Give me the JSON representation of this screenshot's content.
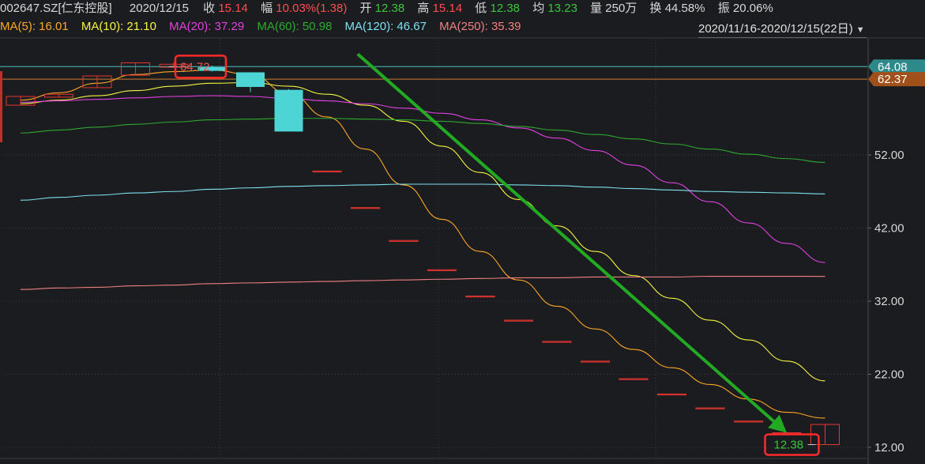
{
  "header": {
    "code": "002647.SZ[仁东控股]",
    "date": "2020/12/15",
    "close_label": "收",
    "close": "15.14",
    "amp_label": "幅",
    "amp": "10.03%(1.38)",
    "open_label": "开",
    "open": "12.38",
    "high_label": "高",
    "high": "15.14",
    "low_label": "低",
    "low": "12.38",
    "avg_label": "均",
    "avg": "13.23",
    "vol_label": "量",
    "vol": "250万",
    "turnover_label": "换",
    "turnover": "44.58%",
    "swing_label": "振",
    "swing": "20.06%"
  },
  "ma": {
    "ma5": "MA(5): 16.01",
    "ma10": "MA(10): 21.10",
    "ma20": "MA(20): 37.29",
    "ma60": "MA(60): 50.98",
    "ma120": "MA(120): 46.67",
    "ma250": "MA(250): 35.39"
  },
  "range": {
    "label": "2020/11/16-2020/12/15(22日)",
    "dropdown_icon": "chevron-down-icon"
  },
  "colors": {
    "up": "#e8352f",
    "down": "#4dd4d4",
    "ma5": "#ffa726",
    "ma10": "#f5f542",
    "ma20": "#e040e0",
    "ma60": "#2eaa2e",
    "ma120": "#7fe0f0",
    "ma250": "#f08080",
    "arrow": "#22aa22"
  },
  "chart_data": {
    "type": "candlestick",
    "ylim": [
      10,
      68
    ],
    "y_ticks": [
      "52.00",
      "42.00",
      "32.00",
      "22.00",
      "12.00"
    ],
    "y_tick_values": [
      52,
      42,
      32,
      22,
      12
    ],
    "price_markers": [
      {
        "label": "64.08",
        "value": 64.08
      },
      {
        "label": "62.37",
        "value": 62.37
      }
    ],
    "annotations": {
      "high": "64.72",
      "high_value": 64.72,
      "low": "12.38",
      "low_value": 12.38
    },
    "candles": [
      {
        "o": 58.8,
        "c": 60.0,
        "h": 60.0,
        "l": 58.8
      },
      {
        "o": 59.9,
        "c": 60.3,
        "h": 60.3,
        "l": 59.9
      },
      {
        "o": 61.2,
        "c": 62.8,
        "h": 62.8,
        "l": 61.2
      },
      {
        "o": 62.9,
        "c": 64.6,
        "h": 64.6,
        "l": 62.9
      },
      {
        "o": 64.0,
        "c": 64.4,
        "h": 64.72,
        "l": 64.0
      },
      {
        "o": 64.0,
        "c": 63.5,
        "h": 64.2,
        "l": 63.4
      },
      {
        "o": 63.3,
        "c": 61.3,
        "h": 63.3,
        "l": 60.6
      },
      {
        "o": 60.9,
        "c": 55.2,
        "h": 61.0,
        "l": 55.2
      },
      {
        "o": 49.8,
        "c": 49.8,
        "h": 49.8,
        "l": 49.8
      },
      {
        "o": 44.8,
        "c": 44.8,
        "h": 44.8,
        "l": 44.8
      },
      {
        "o": 40.3,
        "c": 40.3,
        "h": 40.3,
        "l": 40.3
      },
      {
        "o": 36.3,
        "c": 36.3,
        "h": 36.3,
        "l": 36.3
      },
      {
        "o": 32.7,
        "c": 32.7,
        "h": 32.7,
        "l": 32.7
      },
      {
        "o": 29.4,
        "c": 29.4,
        "h": 29.4,
        "l": 29.4
      },
      {
        "o": 26.5,
        "c": 26.5,
        "h": 26.5,
        "l": 26.5
      },
      {
        "o": 23.8,
        "c": 23.8,
        "h": 23.8,
        "l": 23.8
      },
      {
        "o": 21.4,
        "c": 21.4,
        "h": 21.4,
        "l": 21.4
      },
      {
        "o": 19.3,
        "c": 19.3,
        "h": 19.3,
        "l": 19.3
      },
      {
        "o": 17.4,
        "c": 17.4,
        "h": 17.4,
        "l": 17.4
      },
      {
        "o": 15.6,
        "c": 15.6,
        "h": 15.6,
        "l": 15.6
      },
      {
        "o": 14.0,
        "c": 14.0,
        "h": 14.0,
        "l": 14.0
      },
      {
        "o": 12.38,
        "c": 15.14,
        "h": 15.14,
        "l": 12.38
      }
    ],
    "ma_lines": [
      {
        "name": "MA(5)",
        "key": "ma5",
        "values": [
          59.5,
          60.5,
          61.8,
          63.0,
          63.4,
          63.6,
          63.0,
          60.4,
          57.2,
          52.8,
          47.9,
          43.2,
          38.8,
          34.9,
          31.3,
          28.2,
          25.4,
          22.9,
          20.6,
          18.6,
          16.8,
          16.01
        ]
      },
      {
        "name": "MA(10)",
        "key": "ma10",
        "values": [
          59.0,
          59.5,
          60.1,
          60.8,
          61.4,
          61.8,
          61.9,
          61.4,
          60.3,
          58.8,
          56.6,
          53.2,
          49.6,
          45.9,
          42.3,
          38.8,
          35.5,
          32.4,
          29.4,
          26.7,
          23.8,
          21.1
        ]
      },
      {
        "name": "MA(20)",
        "key": "ma20",
        "values": [
          59.2,
          59.4,
          59.6,
          59.8,
          60.0,
          60.1,
          60.0,
          59.7,
          59.4,
          59.0,
          58.4,
          57.7,
          56.8,
          55.7,
          54.3,
          52.6,
          50.6,
          48.2,
          45.6,
          42.7,
          39.9,
          37.29
        ]
      },
      {
        "name": "MA(60)",
        "key": "ma60",
        "values": [
          55.0,
          55.4,
          55.8,
          56.2,
          56.5,
          56.8,
          56.9,
          57.0,
          57.0,
          56.9,
          56.8,
          56.6,
          56.3,
          55.9,
          55.4,
          54.8,
          54.2,
          53.5,
          52.8,
          52.1,
          51.5,
          50.98
        ]
      },
      {
        "name": "MA(120)",
        "key": "ma120",
        "values": [
          45.8,
          46.2,
          46.5,
          46.8,
          47.0,
          47.3,
          47.5,
          47.7,
          47.8,
          47.9,
          48.0,
          48.0,
          48.0,
          47.9,
          47.8,
          47.6,
          47.4,
          47.2,
          47.0,
          46.9,
          46.8,
          46.67
        ]
      },
      {
        "name": "MA(250)",
        "key": "ma250",
        "values": [
          33.6,
          33.8,
          33.9,
          34.1,
          34.2,
          34.4,
          34.5,
          34.6,
          34.7,
          34.8,
          34.9,
          35.0,
          35.1,
          35.2,
          35.2,
          35.3,
          35.3,
          35.3,
          35.4,
          35.4,
          35.4,
          35.39
        ]
      }
    ],
    "trend_arrow": {
      "from_index": 8.8,
      "from_value": 65.8,
      "to_index": 20.0,
      "to_value": 14.0
    }
  }
}
